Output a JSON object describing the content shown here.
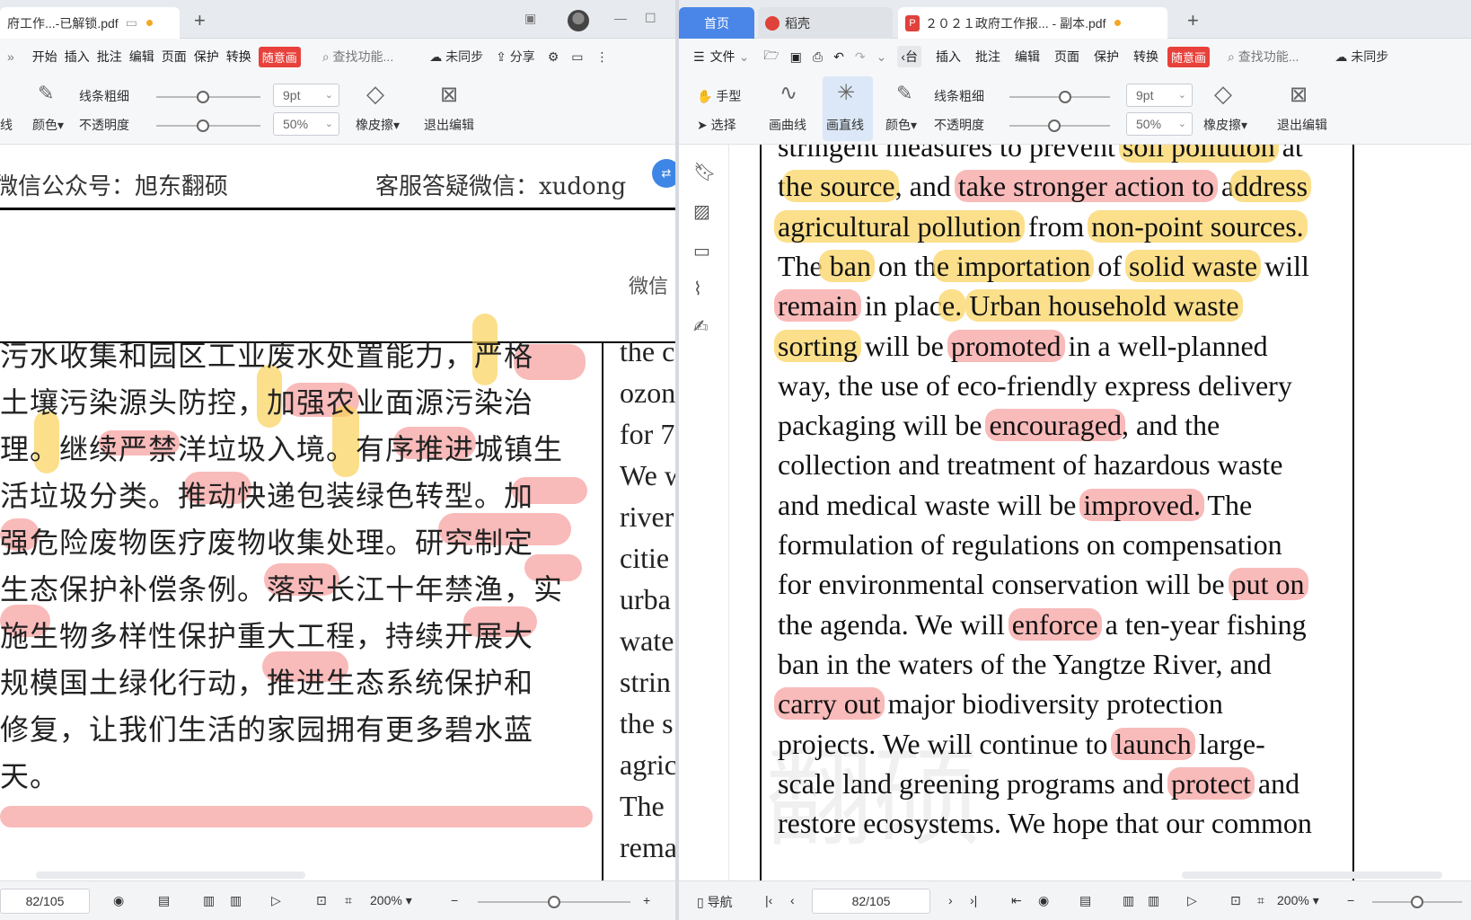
{
  "left": {
    "tab": {
      "title": "府工作...-已解锁.pdf"
    },
    "menu": {
      "items": [
        "开始",
        "插入",
        "批注",
        "编辑",
        "页面",
        "保护",
        "转换"
      ],
      "badge": "随意画",
      "search_placeholder": "查找功能...",
      "sync": "未同步",
      "share": "分享"
    },
    "ink": {
      "line_width_label": "线条粗细",
      "color_label": "颜色",
      "opacity_label": "不透明度",
      "width_value": "9pt",
      "opacity_value": "50%",
      "eraser_label": "橡皮擦",
      "exit_label": "退出编辑",
      "partial_label": "线",
      "width_slider_level": 0.45,
      "opacity_slider_level": 0.45
    },
    "doc": {
      "header_left": "微信公众号：旭东翻硕",
      "header_right": "客服答疑微信：xudong",
      "sub_right": "微信",
      "zh_lines": [
        "污水收集和园区工业废水处置能力，严格",
        "土壤污染源头防控，加强农业面源污染治",
        "理。继续严禁洋垃圾入境。有序推进城镇生",
        "活垃圾分类。推动快递包装绿色转型。加",
        "强危险废物医疗废物收集处理。研究制定",
        "生态保护补偿条例。落实长江十年禁渔，实",
        "施生物多样性保护重大工程，持续开展大",
        "规模国土绿化行动，推进生态系统保护和",
        "修复，让我们生活的家园拥有更多碧水蓝",
        "天。"
      ],
      "en_fragments": [
        "the c",
        "ozon",
        "for 7",
        "We w",
        "river",
        "citie",
        "urba",
        "wate",
        "strin",
        "the s",
        "agric",
        "The",
        "rema"
      ]
    },
    "status": {
      "page": "82/105",
      "zoom": "200%",
      "zoom_level": 0.5
    }
  },
  "right": {
    "tabs": {
      "home": "首页",
      "daoke": "稻壳",
      "doc": "２０２１政府工作报... - 副本.pdf"
    },
    "menu": {
      "file": "文件",
      "items": [
        "插入",
        "批注",
        "编辑",
        "页面",
        "保护",
        "转换"
      ],
      "partial": "台",
      "badge": "随意画",
      "search_placeholder": "查找功能...",
      "sync": "未同步"
    },
    "ink": {
      "hand": "手型",
      "select": "选择",
      "curve": "画曲线",
      "line": "画直线",
      "line_width_label": "线条粗细",
      "color_label": "颜色",
      "opacity_label": "不透明度",
      "width_value": "9pt",
      "opacity_value": "50%",
      "eraser_label": "橡皮擦",
      "exit_label": "退出编辑",
      "width_slider_level": 0.55,
      "opacity_slider_level": 0.45
    },
    "doc": {
      "lines": [
        [
          {
            "t": "stringent measures to prevent "
          },
          {
            "t": "soil pollution",
            "h": "y"
          },
          {
            "t": " at"
          }
        ],
        [
          {
            "t": "t"
          },
          {
            "t": "he source",
            "h": "y"
          },
          {
            "t": ", and "
          },
          {
            "t": "take stronger action to",
            "h": "r"
          },
          {
            "t": " a"
          },
          {
            "t": "ddress",
            "h": "y"
          }
        ],
        [
          {
            "t": "agricultural pollution",
            "h": "y"
          },
          {
            "t": " from "
          },
          {
            "t": "non-point sources.",
            "h": "y"
          }
        ],
        [
          {
            "t": "The"
          },
          {
            "t": " ban",
            "h": "y"
          },
          {
            "t": " on th"
          },
          {
            "t": "e importation",
            "h": "y"
          },
          {
            "t": " of "
          },
          {
            "t": "solid waste",
            "h": "y"
          },
          {
            "t": " will"
          }
        ],
        [
          {
            "t": "remain",
            "h": "r"
          },
          {
            "t": " in plac"
          },
          {
            "t": "e.",
            "h": "y"
          },
          {
            "t": " "
          },
          {
            "t": "Urban household waste ",
            "h": "y"
          }
        ],
        [
          {
            "t": "sorting",
            "h": "y"
          },
          {
            "t": " will be "
          },
          {
            "t": "promoted",
            "h": "r"
          },
          {
            "t": " in a well-planned"
          }
        ],
        [
          {
            "t": "way, the use of eco-friendly express delivery"
          }
        ],
        [
          {
            "t": "packaging will be "
          },
          {
            "t": "encouraged",
            "h": "r"
          },
          {
            "t": ", and the"
          }
        ],
        [
          {
            "t": "collection and treatment of hazardous waste"
          }
        ],
        [
          {
            "t": "and medical waste will be "
          },
          {
            "t": "improved.",
            "h": "r"
          },
          {
            "t": " The"
          }
        ],
        [
          {
            "t": "formulation of regulations on compensation"
          }
        ],
        [
          {
            "t": "for environmental conservation will be "
          },
          {
            "t": "put on",
            "h": "r"
          }
        ],
        [
          {
            "t": "the agenda. We will "
          },
          {
            "t": "enforce",
            "h": "r"
          },
          {
            "t": " a ten-year fishing"
          }
        ],
        [
          {
            "t": "ban in the waters of the Yangtze River, and"
          }
        ],
        [
          {
            "t": "carry out",
            "h": "r"
          },
          {
            "t": " major biodiversity protection"
          }
        ],
        [
          {
            "t": "projects. We will continue to "
          },
          {
            "t": "launch",
            "h": "r"
          },
          {
            "t": " large-"
          }
        ],
        [
          {
            "t": "scale land greening programs and "
          },
          {
            "t": "protect",
            "h": "r"
          },
          {
            "t": " and"
          }
        ],
        [
          {
            "t": "restore ecosystems. We hope that our common"
          }
        ]
      ]
    },
    "status": {
      "nav": "导航",
      "page": "82/105",
      "zoom": "200%",
      "zoom_level": 0.5
    }
  }
}
